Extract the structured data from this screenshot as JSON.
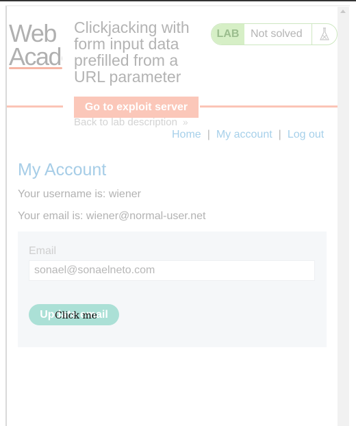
{
  "header": {
    "logo_line1": "Web S",
    "logo_line2": "Acade",
    "lab_title": "Clickjacking with form input data prefilled from a URL parameter",
    "exploit_button": "Go to exploit server",
    "back_link": "Back to lab description",
    "back_chevron": "»",
    "lab_badge": "LAB",
    "lab_status": "Not solved"
  },
  "nav": {
    "home": "Home",
    "sep1": "|",
    "my_account": "My account",
    "sep2": "|",
    "logout": "Log out"
  },
  "account": {
    "title": "My Account",
    "username_line": "Your username is: wiener",
    "email_line": "Your email is: wiener@normal-user.net"
  },
  "form": {
    "email_label": "Email",
    "email_value": "sonael@sonaelneto.com",
    "submit_label": "Update email"
  },
  "decoy": {
    "text": "Click me"
  },
  "colors": {
    "accent_orange": "#fbc7b9",
    "link_blue": "#a6d0ea",
    "button_teal": "#abe0d6",
    "lab_green": "#d6efc6"
  }
}
